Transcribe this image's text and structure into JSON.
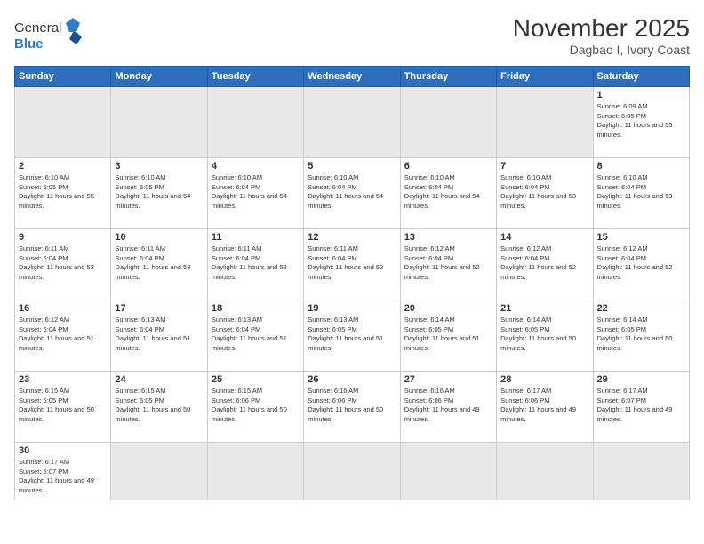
{
  "header": {
    "logo_general": "General",
    "logo_blue": "Blue",
    "month_title": "November 2025",
    "location": "Dagbao I, Ivory Coast"
  },
  "days_of_week": [
    "Sunday",
    "Monday",
    "Tuesday",
    "Wednesday",
    "Thursday",
    "Friday",
    "Saturday"
  ],
  "weeks": [
    [
      {
        "day": "",
        "empty": true
      },
      {
        "day": "",
        "empty": true
      },
      {
        "day": "",
        "empty": true
      },
      {
        "day": "",
        "empty": true
      },
      {
        "day": "",
        "empty": true
      },
      {
        "day": "",
        "empty": true
      },
      {
        "day": "1",
        "sunrise": "6:09 AM",
        "sunset": "6:05 PM",
        "daylight": "11 hours and 55 minutes."
      }
    ],
    [
      {
        "day": "2",
        "sunrise": "6:10 AM",
        "sunset": "6:05 PM",
        "daylight": "11 hours and 55 minutes."
      },
      {
        "day": "3",
        "sunrise": "6:10 AM",
        "sunset": "6:05 PM",
        "daylight": "11 hours and 54 minutes."
      },
      {
        "day": "4",
        "sunrise": "6:10 AM",
        "sunset": "6:04 PM",
        "daylight": "11 hours and 54 minutes."
      },
      {
        "day": "5",
        "sunrise": "6:10 AM",
        "sunset": "6:04 PM",
        "daylight": "11 hours and 54 minutes."
      },
      {
        "day": "6",
        "sunrise": "6:10 AM",
        "sunset": "6:04 PM",
        "daylight": "11 hours and 54 minutes."
      },
      {
        "day": "7",
        "sunrise": "6:10 AM",
        "sunset": "6:04 PM",
        "daylight": "11 hours and 53 minutes."
      },
      {
        "day": "8",
        "sunrise": "6:10 AM",
        "sunset": "6:04 PM",
        "daylight": "11 hours and 53 minutes."
      }
    ],
    [
      {
        "day": "9",
        "sunrise": "6:11 AM",
        "sunset": "6:04 PM",
        "daylight": "11 hours and 53 minutes."
      },
      {
        "day": "10",
        "sunrise": "6:11 AM",
        "sunset": "6:04 PM",
        "daylight": "11 hours and 53 minutes."
      },
      {
        "day": "11",
        "sunrise": "6:11 AM",
        "sunset": "6:04 PM",
        "daylight": "11 hours and 53 minutes."
      },
      {
        "day": "12",
        "sunrise": "6:11 AM",
        "sunset": "6:04 PM",
        "daylight": "11 hours and 52 minutes."
      },
      {
        "day": "13",
        "sunrise": "6:12 AM",
        "sunset": "6:04 PM",
        "daylight": "11 hours and 52 minutes."
      },
      {
        "day": "14",
        "sunrise": "6:12 AM",
        "sunset": "6:04 PM",
        "daylight": "11 hours and 52 minutes."
      },
      {
        "day": "15",
        "sunrise": "6:12 AM",
        "sunset": "6:04 PM",
        "daylight": "11 hours and 52 minutes."
      }
    ],
    [
      {
        "day": "16",
        "sunrise": "6:12 AM",
        "sunset": "6:04 PM",
        "daylight": "11 hours and 51 minutes."
      },
      {
        "day": "17",
        "sunrise": "6:13 AM",
        "sunset": "6:04 PM",
        "daylight": "11 hours and 51 minutes."
      },
      {
        "day": "18",
        "sunrise": "6:13 AM",
        "sunset": "6:04 PM",
        "daylight": "11 hours and 51 minutes."
      },
      {
        "day": "19",
        "sunrise": "6:13 AM",
        "sunset": "6:05 PM",
        "daylight": "11 hours and 51 minutes."
      },
      {
        "day": "20",
        "sunrise": "6:14 AM",
        "sunset": "6:05 PM",
        "daylight": "11 hours and 51 minutes."
      },
      {
        "day": "21",
        "sunrise": "6:14 AM",
        "sunset": "6:05 PM",
        "daylight": "11 hours and 50 minutes."
      },
      {
        "day": "22",
        "sunrise": "6:14 AM",
        "sunset": "6:05 PM",
        "daylight": "11 hours and 50 minutes."
      }
    ],
    [
      {
        "day": "23",
        "sunrise": "6:15 AM",
        "sunset": "6:05 PM",
        "daylight": "11 hours and 50 minutes."
      },
      {
        "day": "24",
        "sunrise": "6:15 AM",
        "sunset": "6:05 PM",
        "daylight": "11 hours and 50 minutes."
      },
      {
        "day": "25",
        "sunrise": "6:15 AM",
        "sunset": "6:06 PM",
        "daylight": "11 hours and 50 minutes."
      },
      {
        "day": "26",
        "sunrise": "6:16 AM",
        "sunset": "6:06 PM",
        "daylight": "11 hours and 50 minutes."
      },
      {
        "day": "27",
        "sunrise": "6:16 AM",
        "sunset": "6:06 PM",
        "daylight": "11 hours and 49 minutes."
      },
      {
        "day": "28",
        "sunrise": "6:17 AM",
        "sunset": "6:06 PM",
        "daylight": "11 hours and 49 minutes."
      },
      {
        "day": "29",
        "sunrise": "6:17 AM",
        "sunset": "6:07 PM",
        "daylight": "11 hours and 49 minutes."
      }
    ],
    [
      {
        "day": "30",
        "sunrise": "6:17 AM",
        "sunset": "6:07 PM",
        "daylight": "11 hours and 49 minutes.",
        "last": true
      },
      {
        "day": "",
        "empty": true,
        "last": true
      },
      {
        "day": "",
        "empty": true,
        "last": true
      },
      {
        "day": "",
        "empty": true,
        "last": true
      },
      {
        "day": "",
        "empty": true,
        "last": true
      },
      {
        "day": "",
        "empty": true,
        "last": true
      },
      {
        "day": "",
        "empty": true,
        "last": true
      }
    ]
  ]
}
